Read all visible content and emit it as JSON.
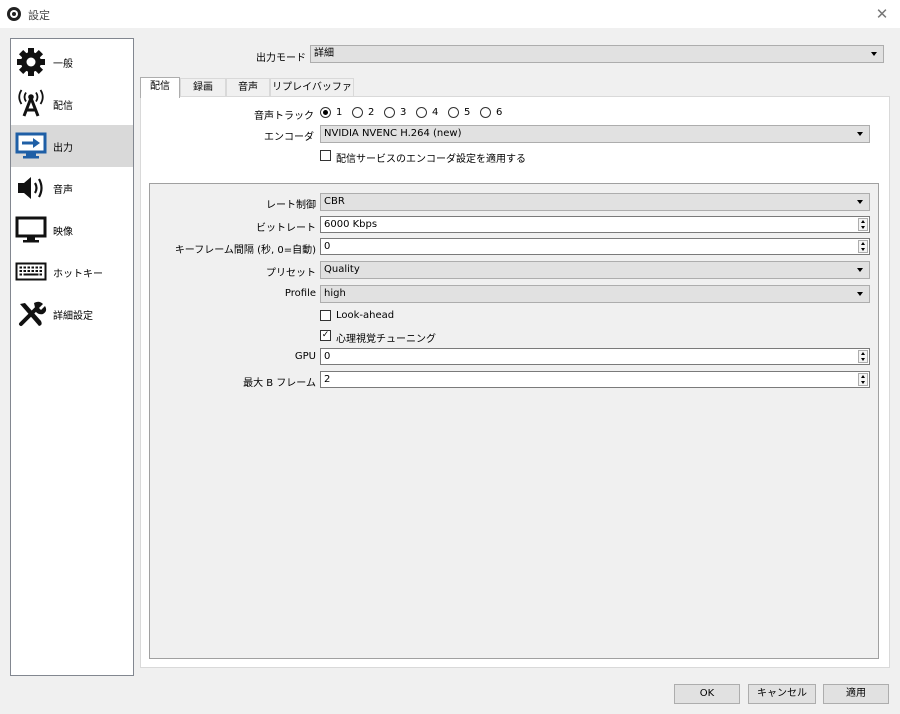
{
  "window": {
    "title": "設定",
    "close_glyph": "✕"
  },
  "sidebar": {
    "items": [
      {
        "label": "一般",
        "icon": "gear-icon"
      },
      {
        "label": "配信",
        "icon": "broadcast-antenna-icon"
      },
      {
        "label": "出力",
        "icon": "monitor-output-icon",
        "active": true
      },
      {
        "label": "音声",
        "icon": "speaker-icon"
      },
      {
        "label": "映像",
        "icon": "monitor-icon"
      },
      {
        "label": "ホットキー",
        "icon": "keyboard-icon"
      },
      {
        "label": "詳細設定",
        "icon": "tools-icon"
      }
    ]
  },
  "output_mode": {
    "label": "出力モード",
    "value": "詳細"
  },
  "tabs": [
    {
      "label": "配信",
      "active": true
    },
    {
      "label": "録画"
    },
    {
      "label": "音声"
    },
    {
      "label": "リプレイバッファ"
    }
  ],
  "stream": {
    "audio_track": {
      "label": "音声トラック",
      "options": [
        "1",
        "2",
        "3",
        "4",
        "5",
        "6"
      ],
      "selected": "1"
    },
    "encoder": {
      "label": "エンコーダ",
      "value": "NVIDIA NVENC H.264 (new)"
    },
    "apply_service_settings": {
      "label": "配信サービスのエンコーダ設定を適用する",
      "checked": false
    }
  },
  "encoder_settings": {
    "rate_control": {
      "label": "レート制御",
      "value": "CBR"
    },
    "bitrate": {
      "label": "ビットレート",
      "value": "6000 Kbps"
    },
    "keyframe_interval": {
      "label": "キーフレーム間隔 (秒, 0=自動)",
      "value": "0"
    },
    "preset": {
      "label": "プリセット",
      "value": "Quality"
    },
    "profile": {
      "label": "Profile",
      "value": "high"
    },
    "look_ahead": {
      "label": "Look-ahead",
      "checked": false
    },
    "psycho_visual_tuning": {
      "label": "心理視覚チューニング",
      "checked": true,
      "check_glyph": "✓"
    },
    "gpu": {
      "label": "GPU",
      "value": "0"
    },
    "max_b_frames": {
      "label": "最大 B フレーム",
      "value": "2"
    }
  },
  "buttons": {
    "ok": "OK",
    "cancel": "キャンセル",
    "apply": "適用"
  }
}
